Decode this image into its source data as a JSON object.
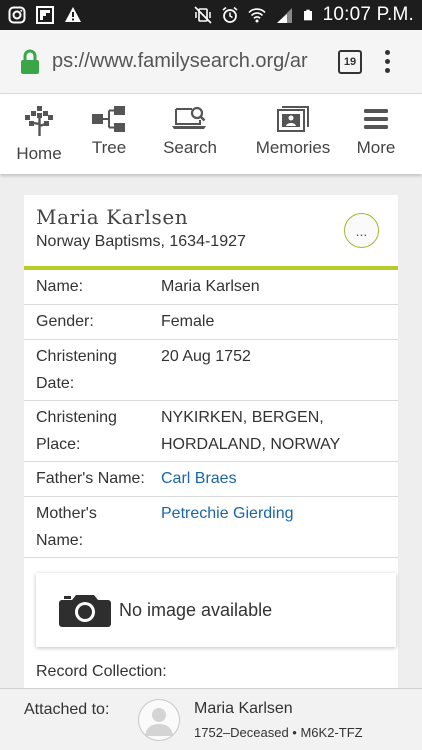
{
  "status_bar": {
    "time": "10:07 P.M.",
    "left_icons": [
      "instagram-icon",
      "flipboard-icon",
      "warning-icon"
    ],
    "right_icons": [
      "vibrate-mute-icon",
      "alarm-icon",
      "wifi-icon",
      "signal-icon",
      "battery-icon"
    ]
  },
  "browser": {
    "url": "ps://www.familysearch.org/ar",
    "tab_count": "19"
  },
  "nav": {
    "items": [
      {
        "label": "Home",
        "icon": "family-tree-home-icon"
      },
      {
        "label": "Tree",
        "icon": "tree-chart-icon"
      },
      {
        "label": "Search",
        "icon": "search-laptop-icon"
      },
      {
        "label": "Memories",
        "icon": "memories-icon"
      },
      {
        "label": "More",
        "icon": "menu-icon"
      }
    ]
  },
  "record": {
    "name": "Maria Karlsen",
    "collection": "Norway Baptisms, 1634-1927",
    "more_label": "...",
    "accent_color": "#b7cc2a",
    "fields": [
      {
        "label_lines": [
          "Name:"
        ],
        "value_lines": [
          "Maria Karlsen"
        ],
        "link": false
      },
      {
        "label_lines": [
          "Gender:"
        ],
        "value_lines": [
          "Female"
        ],
        "link": false
      },
      {
        "label_lines": [
          "Christening",
          "Date:"
        ],
        "value_lines": [
          "20 Aug 1752"
        ],
        "link": false
      },
      {
        "label_lines": [
          "Christening",
          "Place:"
        ],
        "value_lines": [
          "NYKIRKEN, BERGEN,",
          "HORDALAND, NORWAY"
        ],
        "link": false
      },
      {
        "label_lines": [
          "Father's Name:"
        ],
        "value_lines": [
          "Carl Braes"
        ],
        "link": true
      },
      {
        "label_lines": [
          "Mother's",
          "Name:"
        ],
        "value_lines": [
          "Petrechie Gierding"
        ],
        "link": true
      }
    ]
  },
  "image_box": {
    "text": "No image available",
    "icon": "camera-icon"
  },
  "record_collection_label": "Record Collection:",
  "attached": {
    "label": "Attached to:",
    "name": "Maria Karlsen",
    "details": "1752–Deceased • M6K2-TFZ"
  }
}
